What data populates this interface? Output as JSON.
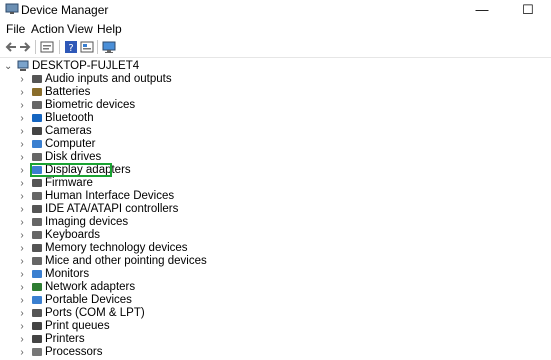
{
  "window": {
    "title": "Device Manager",
    "minimize_glyph": "—",
    "maximize_glyph": "☐"
  },
  "menu": [
    "File",
    "Action",
    "View",
    "Help"
  ],
  "toolbar": [
    "back-icon",
    "forward-icon",
    "properties-icon",
    "help-icon",
    "scan-icon",
    "monitor-icon"
  ],
  "tree": {
    "root": "DESKTOP-FUJLET4",
    "root_chevron": "⌄",
    "child_chevron": "›",
    "items": [
      {
        "label": "Audio inputs and outputs",
        "icon": "speaker-icon"
      },
      {
        "label": "Batteries",
        "icon": "battery-icon"
      },
      {
        "label": "Biometric devices",
        "icon": "fingerprint-icon"
      },
      {
        "label": "Bluetooth",
        "icon": "bluetooth-icon"
      },
      {
        "label": "Cameras",
        "icon": "camera-icon"
      },
      {
        "label": "Computer",
        "icon": "computer-icon"
      },
      {
        "label": "Disk drives",
        "icon": "disk-drive-icon"
      },
      {
        "label": "Display adapters",
        "icon": "display-adapter-icon"
      },
      {
        "label": "Firmware",
        "icon": "firmware-icon"
      },
      {
        "label": "Human Interface Devices",
        "icon": "hid-icon"
      },
      {
        "label": "IDE ATA/ATAPI controllers",
        "icon": "ide-controller-icon"
      },
      {
        "label": "Imaging devices",
        "icon": "imaging-icon"
      },
      {
        "label": "Keyboards",
        "icon": "keyboard-icon"
      },
      {
        "label": "Memory technology devices",
        "icon": "memory-icon"
      },
      {
        "label": "Mice and other pointing devices",
        "icon": "mouse-icon"
      },
      {
        "label": "Monitors",
        "icon": "monitor-icon"
      },
      {
        "label": "Network adapters",
        "icon": "network-icon"
      },
      {
        "label": "Portable Devices",
        "icon": "portable-device-icon"
      },
      {
        "label": "Ports (COM & LPT)",
        "icon": "port-icon"
      },
      {
        "label": "Print queues",
        "icon": "print-queue-icon"
      },
      {
        "label": "Printers",
        "icon": "printer-icon"
      },
      {
        "label": "Processors",
        "icon": "processor-icon"
      }
    ]
  },
  "highlight_color": "#1aa332"
}
